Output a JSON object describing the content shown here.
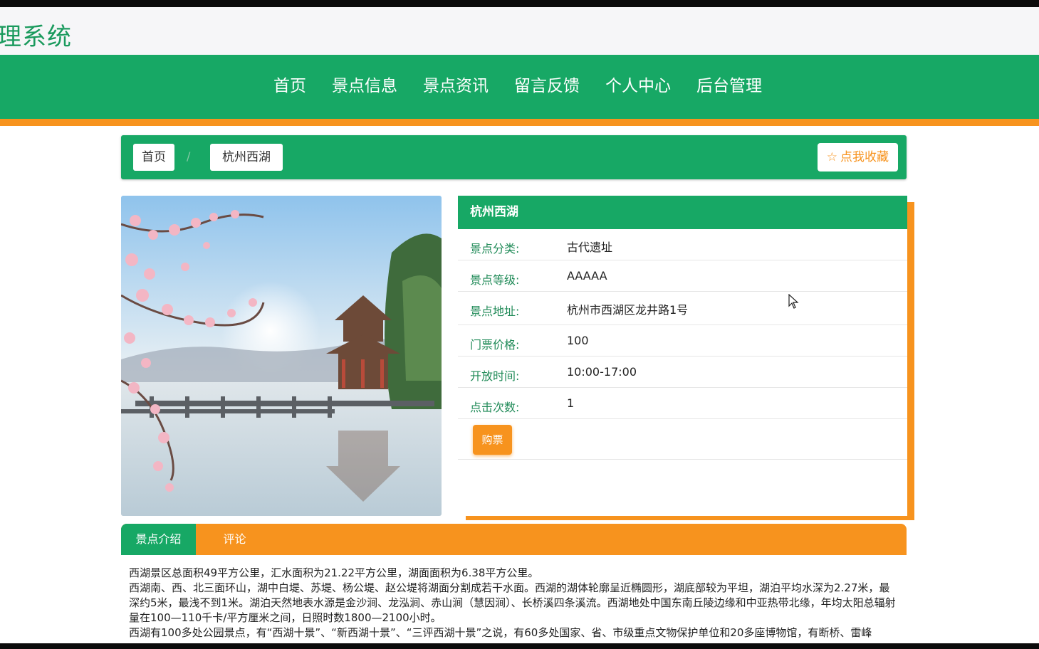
{
  "header": {
    "site_title": "理系统"
  },
  "nav": {
    "items": [
      "首页",
      "景点信息",
      "景点资讯",
      "留言反馈",
      "个人中心",
      "后台管理"
    ]
  },
  "breadcrumb": {
    "home": "首页",
    "separator": "/",
    "current": "杭州西湖"
  },
  "favorite_button": {
    "label": "点我收藏",
    "icon": "star-outline-icon"
  },
  "detail": {
    "title": "杭州西湖",
    "rows": [
      {
        "label": "景点分类:",
        "value": "古代遗址"
      },
      {
        "label": "景点等级:",
        "value": "AAAAA"
      },
      {
        "label": "景点地址:",
        "value": "杭州市西湖区龙井路1号"
      },
      {
        "label": "门票价格:",
        "value": "100"
      },
      {
        "label": "开放时间:",
        "value": "10:00-17:00"
      },
      {
        "label": "点击次数:",
        "value": "1"
      }
    ],
    "buy_button": "购票"
  },
  "tabs": {
    "active": "景点介绍",
    "other": "评论"
  },
  "description": [
    "西湖景区总面积49平方公里，汇水面积为21.22平方公里，湖面面积为6.38平方公里。",
    "西湖南、西、北三面环山，湖中白堤、苏堤、杨公堤、赵公堤将湖面分割成若干水面。西湖的湖体轮廓呈近椭圆形，湖底部较为平坦，湖泊平均水深为2.27米，最深约5米，最浅不到1米。湖泊天然地表水源是金沙涧、龙泓涧、赤山涧（慧因涧）、长桥溪四条溪流。西湖地处中国东南丘陵边缘和中亚热带北缘，年均太阳总辐射量在100—110千卡/平方厘米之间，日照时数1800—2100小时。",
    "西湖有100多处公园景点，有“西湖十景”、“新西湖十景”、“三评西湖十景”之说，有60多处国家、省、市级重点文物保护单位和20多座博物馆，有断桥、雷峰"
  ],
  "colors": {
    "primary": "#17a865",
    "accent": "#f7931e"
  }
}
